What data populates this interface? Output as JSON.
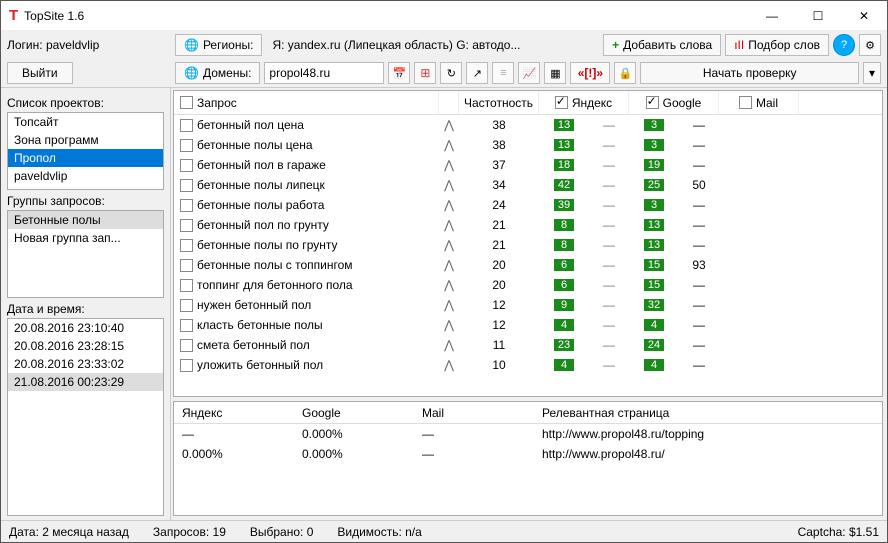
{
  "window": {
    "title": "TopSite 1.6"
  },
  "login": {
    "label": "Логин:",
    "user": "paveldvlip",
    "logout": "Выйти"
  },
  "toolbar": {
    "regions_label": "Регионы:",
    "regions_info": "Я: yandex.ru (Липецкая область)  G: автодо...",
    "add_words": "Добавить слова",
    "word_pick": "Подбор слов",
    "domains_label": "Домены:",
    "domain": "propol48.ru",
    "start_check": "Начать проверку"
  },
  "sidebar": {
    "projects_label": "Список проектов:",
    "projects": [
      "Топсайт",
      "Зона программ",
      "Пропол",
      "paveldvlip"
    ],
    "projects_sel": 2,
    "groups_label": "Группы запросов:",
    "groups": [
      "Бетонные полы",
      "Новая группа зап..."
    ],
    "groups_sel": 0,
    "dates_label": "Дата и время:",
    "dates": [
      "20.08.2016 23:10:40",
      "20.08.2016 23:28:15",
      "20.08.2016 23:33:02",
      "21.08.2016 00:23:29"
    ],
    "dates_sel": 3
  },
  "grid": {
    "headers": {
      "query": "Запрос",
      "freq": "Частотность",
      "yandex": "Яндекс",
      "google": "Google",
      "mail": "Mail"
    },
    "rows": [
      {
        "q": "бетонный пол цена",
        "f": 38,
        "y": 13,
        "g": 3
      },
      {
        "q": "бетонные полы цена",
        "f": 38,
        "y": 13,
        "g": 3
      },
      {
        "q": "бетонный пол в гараже",
        "f": 37,
        "y": 18,
        "g": 19
      },
      {
        "q": "бетонные полы липецк",
        "f": 34,
        "y": 42,
        "g": 25,
        "gd": 50
      },
      {
        "q": "бетонные полы работа",
        "f": 24,
        "y": 39,
        "g": 3
      },
      {
        "q": "бетонный пол по грунту",
        "f": 21,
        "y": 8,
        "g": 13
      },
      {
        "q": "бетонные полы по грунту",
        "f": 21,
        "y": 8,
        "g": 13
      },
      {
        "q": "бетонные полы с топпингом",
        "f": 20,
        "y": 6,
        "g": 15,
        "gd": 93
      },
      {
        "q": "топпинг для бетонного пола",
        "f": 20,
        "y": 6,
        "g": 15
      },
      {
        "q": "нужен бетонный пол",
        "f": 12,
        "y": 9,
        "g": 32
      },
      {
        "q": "класть бетонные полы",
        "f": 12,
        "y": 4,
        "g": 4
      },
      {
        "q": "смета бетонный пол",
        "f": 11,
        "y": 23,
        "g": 24
      },
      {
        "q": "уложить бетонный пол",
        "f": 10,
        "y": 4,
        "g": 4
      }
    ]
  },
  "detail": {
    "headers": {
      "yandex": "Яндекс",
      "google": "Google",
      "mail": "Mail",
      "page": "Релевантная страница"
    },
    "rows": [
      {
        "y": "—",
        "g": "0.000%",
        "m": "—",
        "p": "http://www.propol48.ru/topping"
      },
      {
        "y": "0.000%",
        "g": "0.000%",
        "m": "—",
        "p": "http://www.propol48.ru/"
      }
    ]
  },
  "status": {
    "date": "Дата: 2 месяца назад",
    "queries": "Запросов: 19",
    "selected": "Выбрано: 0",
    "visibility": "Видимость:   n/a",
    "captcha": "Captcha: $1.51"
  }
}
